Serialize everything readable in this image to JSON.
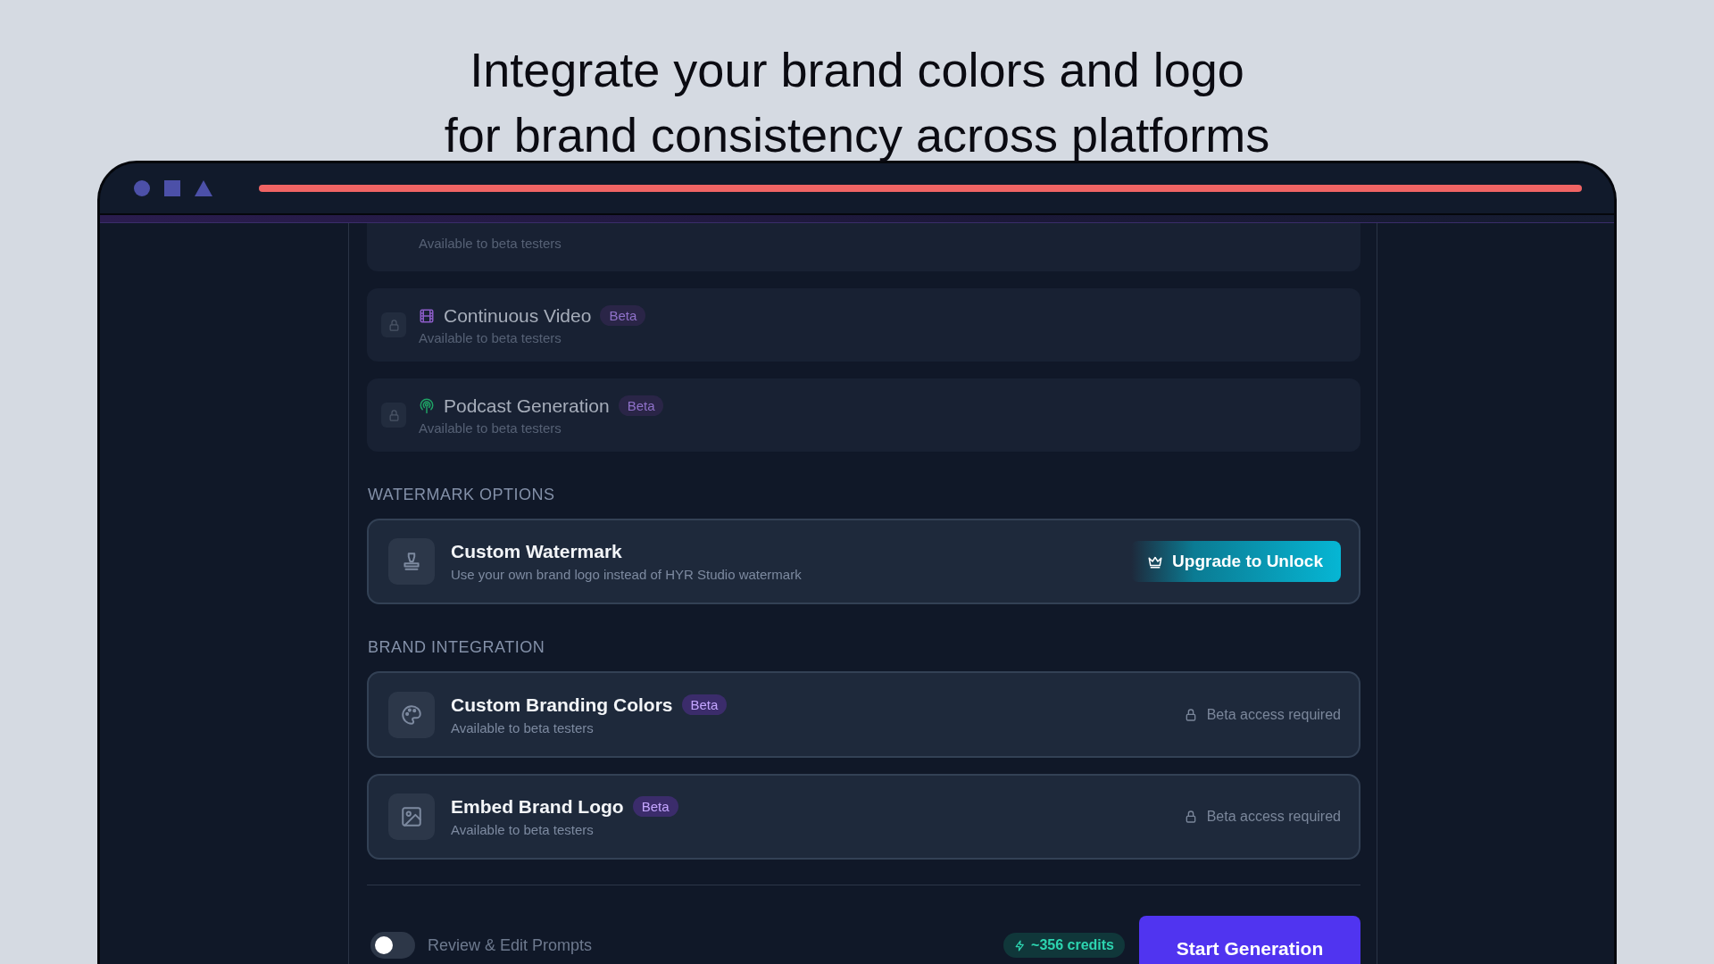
{
  "headline": "Integrate your brand colors and logo for brand consistency across platforms",
  "progress": {
    "level": 1
  },
  "locked_features": [
    {
      "subtitle": "Available to beta testers"
    },
    {
      "kind": "video",
      "title": "Continuous Video",
      "badge": "Beta",
      "subtitle": "Available to beta testers"
    },
    {
      "kind": "podcast",
      "title": "Podcast Generation",
      "badge": "Beta",
      "subtitle": "Available to beta testers"
    }
  ],
  "sections": [
    {
      "heading": "WATERMARK OPTIONS",
      "items": [
        {
          "kind": "watermark",
          "title": "Custom Watermark",
          "subtitle": "Use your own brand logo instead of HYR Studio watermark",
          "action": {
            "kind": "upgrade",
            "label": "Upgrade to Unlock"
          }
        }
      ]
    },
    {
      "heading": "BRAND INTEGRATION",
      "items": [
        {
          "kind": "colors",
          "title": "Custom Branding Colors",
          "badge": "Beta",
          "subtitle": "Available to beta testers",
          "action": {
            "kind": "notice",
            "label": "Beta access required"
          }
        },
        {
          "kind": "logo",
          "title": "Embed Brand Logo",
          "badge": "Beta",
          "subtitle": "Available to beta testers",
          "action": {
            "kind": "notice",
            "label": "Beta access required"
          }
        }
      ]
    }
  ],
  "footer": {
    "toggle": {
      "label": "Review & Edit Prompts",
      "on": false
    },
    "credits": "~356 credits",
    "button": "Start Generation"
  }
}
